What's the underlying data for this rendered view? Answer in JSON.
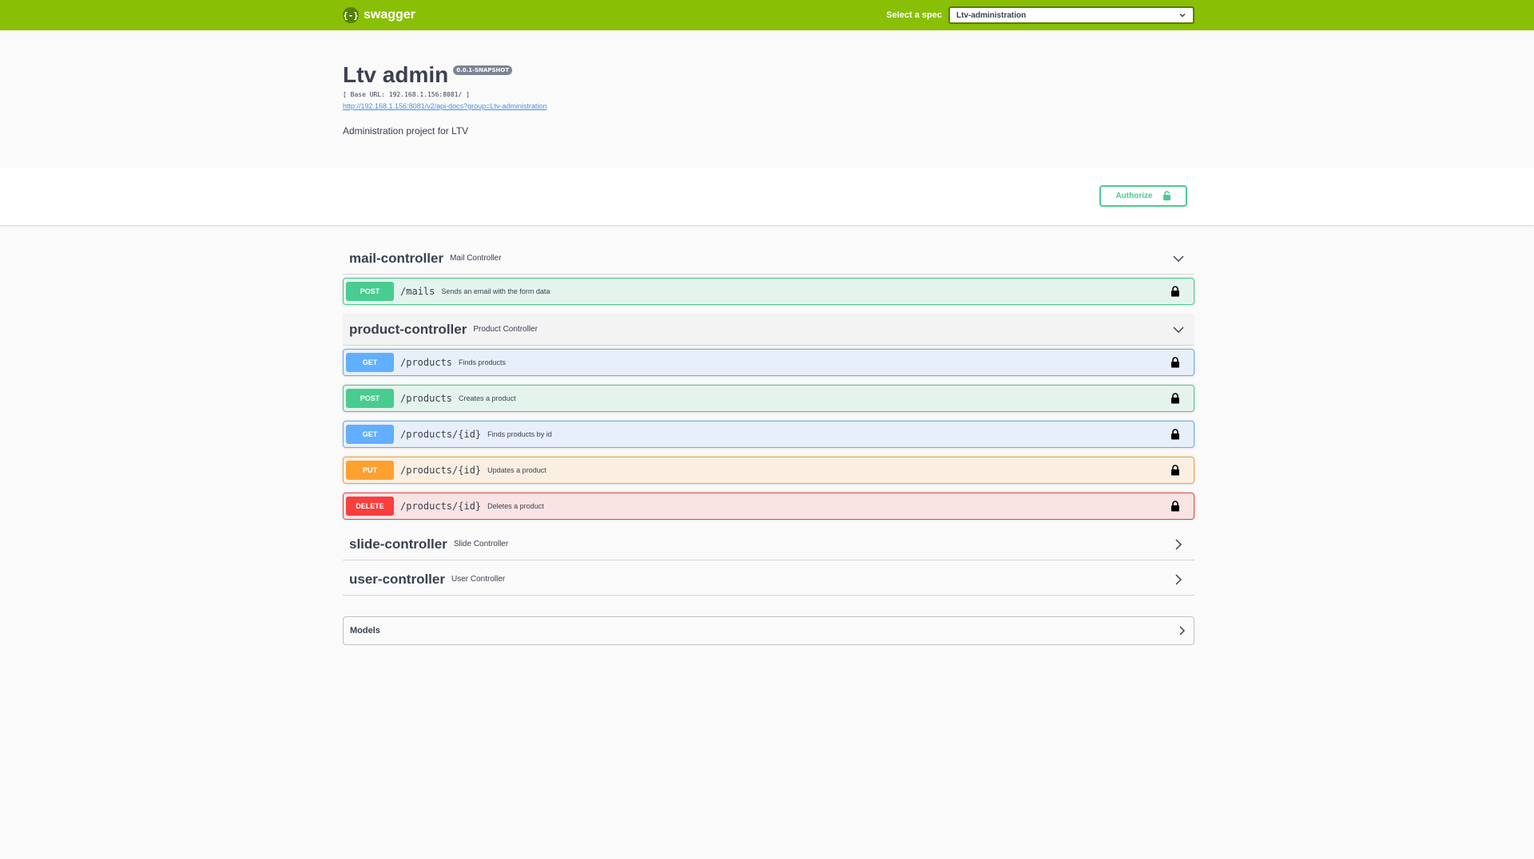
{
  "topbar": {
    "logo_mark": "{-}",
    "logo_text": "swagger",
    "spec_label": "Select a spec",
    "spec_value": "Ltv-administration",
    "bg_color": "#89bf04"
  },
  "info": {
    "title": "Ltv admin",
    "version": "0.0.1-SNAPSHOT",
    "base_url": "[ Base URL: 192.168.1.156:8081/ ]",
    "doc_link": "http://192.168.1.156:8081/v2/api-docs?group=Ltv-administration",
    "description": "Administration project for LTV"
  },
  "authorize": {
    "label": "Authorize"
  },
  "tags": [
    {
      "name": "mail-controller",
      "description": "Mail Controller",
      "expanded": true,
      "operations": [
        {
          "method": "POST",
          "path": "/mails",
          "summary": "Sends an email with the form data"
        }
      ]
    },
    {
      "name": "product-controller",
      "description": "Product Controller",
      "expanded": true,
      "operations": [
        {
          "method": "GET",
          "path": "/products",
          "summary": "Finds products"
        },
        {
          "method": "POST",
          "path": "/products",
          "summary": "Creates a product"
        },
        {
          "method": "GET",
          "path": "/products/{id}",
          "summary": "Finds products by id"
        },
        {
          "method": "PUT",
          "path": "/products/{id}",
          "summary": "Updates a product"
        },
        {
          "method": "DELETE",
          "path": "/products/{id}",
          "summary": "Deletes a product"
        }
      ]
    },
    {
      "name": "slide-controller",
      "description": "Slide Controller",
      "expanded": false,
      "operations": []
    },
    {
      "name": "user-controller",
      "description": "User Controller",
      "expanded": false,
      "operations": []
    }
  ],
  "models": {
    "label": "Models"
  },
  "colors": {
    "post": "#49cc90",
    "get": "#61affe",
    "put": "#fca130",
    "delete": "#f93e3e"
  }
}
